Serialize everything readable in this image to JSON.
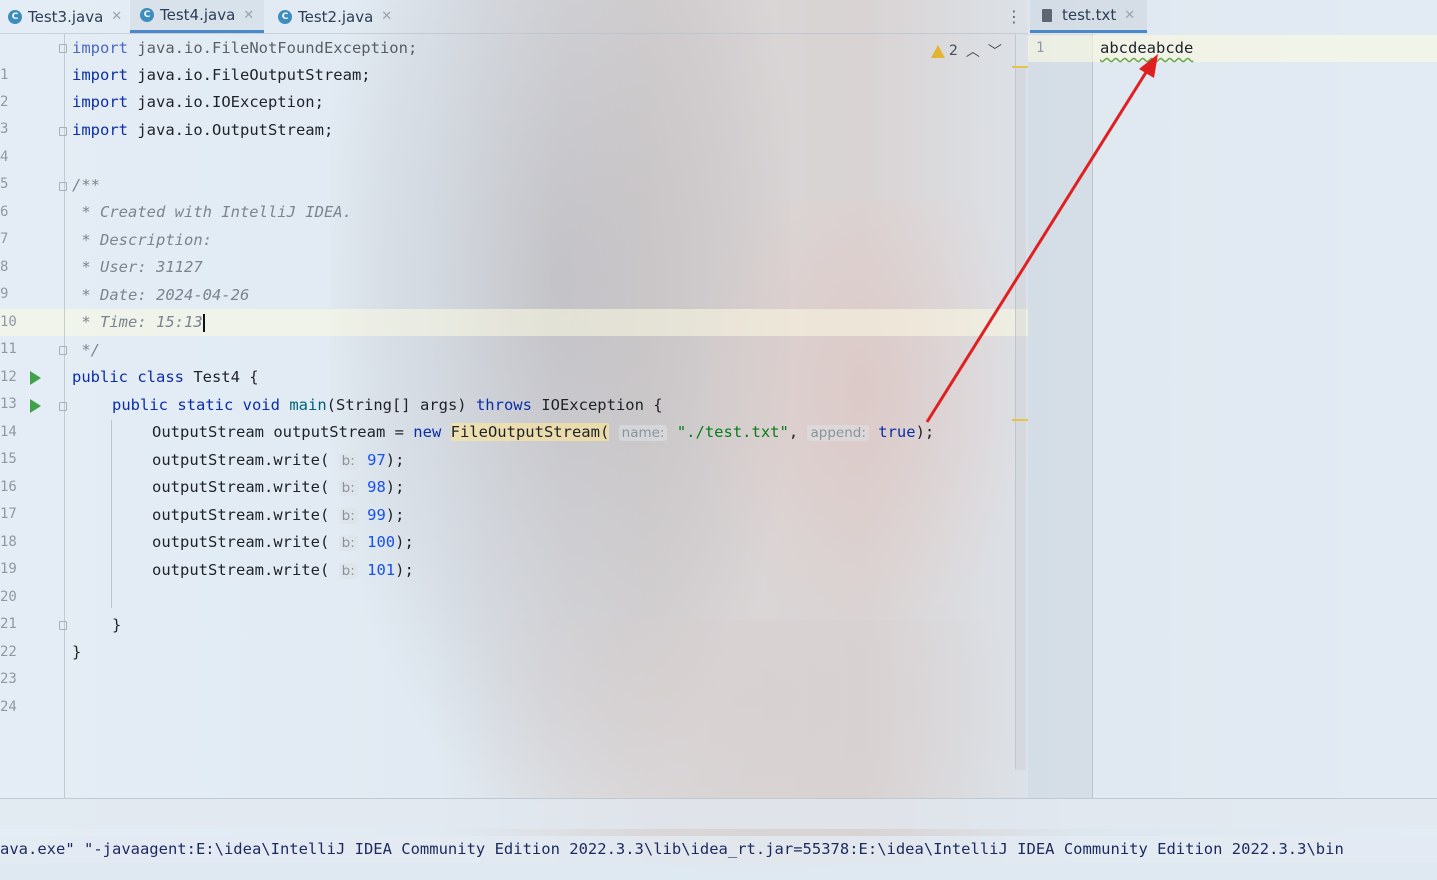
{
  "editor": {
    "tabs": [
      {
        "label": "Test3.java",
        "icon": "java-class-icon",
        "active": false
      },
      {
        "label": "Test4.java",
        "icon": "java-class-icon",
        "active": true
      },
      {
        "label": "Test2.java",
        "icon": "java-class-icon",
        "active": false
      }
    ],
    "inspection_count": "2",
    "line_numbers": [
      "1",
      "2",
      "3",
      "4",
      "5",
      "6",
      "7",
      "8",
      "9",
      "10",
      "11",
      "12",
      "13",
      "14",
      "15",
      "16",
      "17",
      "18",
      "19",
      "20",
      "21",
      "22",
      "23",
      "24"
    ],
    "code": {
      "l1_kw": "import",
      "l1_rest": " java.io.FileNotFoundException;",
      "l2_kw": "import",
      "l2_rest": " java.io.FileOutputStream;",
      "l3_kw": "import",
      "l3_rest": " java.io.IOException;",
      "l4_kw": "import",
      "l4_rest": " java.io.OutputStream;",
      "l6": "/**",
      "l7": " * Created with IntelliJ IDEA.",
      "l8": " * Description:",
      "l9": " * User: 31127",
      "l10": " * Date: 2024-04-26",
      "l11": " * Time: 15:13",
      "l12": " */",
      "l13_kw": "public class",
      "l13_rest": " Test4 {",
      "l14_kw": "public static void",
      "l14_fn": "main",
      "l14_a": "(String[] args) ",
      "l14_kw2": "throws",
      "l14_b": " IOException {",
      "l15_a": "OutputStream outputStream = ",
      "l15_kw": "new",
      "l15_cls": "FileOutputStream",
      "l15_p": "(",
      "l15_hint1": "name:",
      "l15_str": "\"./test.txt\"",
      "l15_c": ", ",
      "l15_hint2": "append:",
      "l15_kw2": "true",
      "l15_end": ");",
      "write_call": "outputStream.write(",
      "write_hint": "b:",
      "write_vals": [
        "97",
        "98",
        "99",
        "100",
        "101"
      ],
      "write_end": ");",
      "l22": "}",
      "l23": "}"
    }
  },
  "right_pane": {
    "tab_label": "test.txt",
    "line_number": "1",
    "content": "abcdeabcde"
  },
  "console": {
    "text": "ava.exe\" \"-javaagent:E:\\idea\\IntelliJ IDEA Community Edition 2022.3.3\\lib\\idea_rt.jar=55378:E:\\idea\\IntelliJ IDEA Community Edition 2022.3.3\\bin"
  },
  "colors": {
    "keyword": "#0b2ea8",
    "string": "#067d17",
    "number": "#1750eb",
    "annotation_arrow": "#e02020",
    "warning": "#e3b332"
  }
}
